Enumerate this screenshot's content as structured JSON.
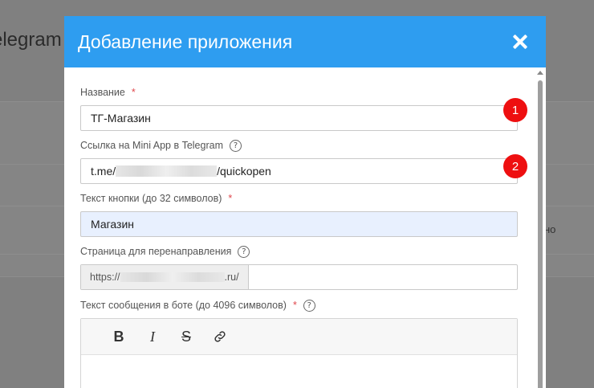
{
  "background": {
    "header_fragment": "elegram",
    "right_fragment": "но"
  },
  "modal": {
    "title": "Добавление приложения",
    "fields": {
      "name": {
        "label": "Название",
        "required": "*",
        "value": "ТГ-Магазин",
        "badge": "1"
      },
      "mini_app_link": {
        "label": "Ссылка на Mini App в Telegram",
        "help": "?",
        "value_prefix": "t.me/",
        "value_suffix": "/quickopen",
        "badge": "2"
      },
      "button_text": {
        "label": "Текст кнопки (до 32 символов)",
        "required": "*",
        "value": "Магазин"
      },
      "redirect_page": {
        "label": "Страница для перенаправления",
        "help": "?",
        "prefix_start": "https://",
        "prefix_end": ".ru/",
        "value": ""
      },
      "bot_message": {
        "label": "Текст сообщения в боте (до 4096 символов)",
        "required": "*",
        "help": "?",
        "toolbar": {
          "bold": "B",
          "italic": "I",
          "strike": "S"
        }
      }
    }
  },
  "colors": {
    "header": "#2e9df0",
    "badge": "#ee0f10",
    "required": "#e0474c",
    "highlight_input": "#e8f0fe"
  }
}
